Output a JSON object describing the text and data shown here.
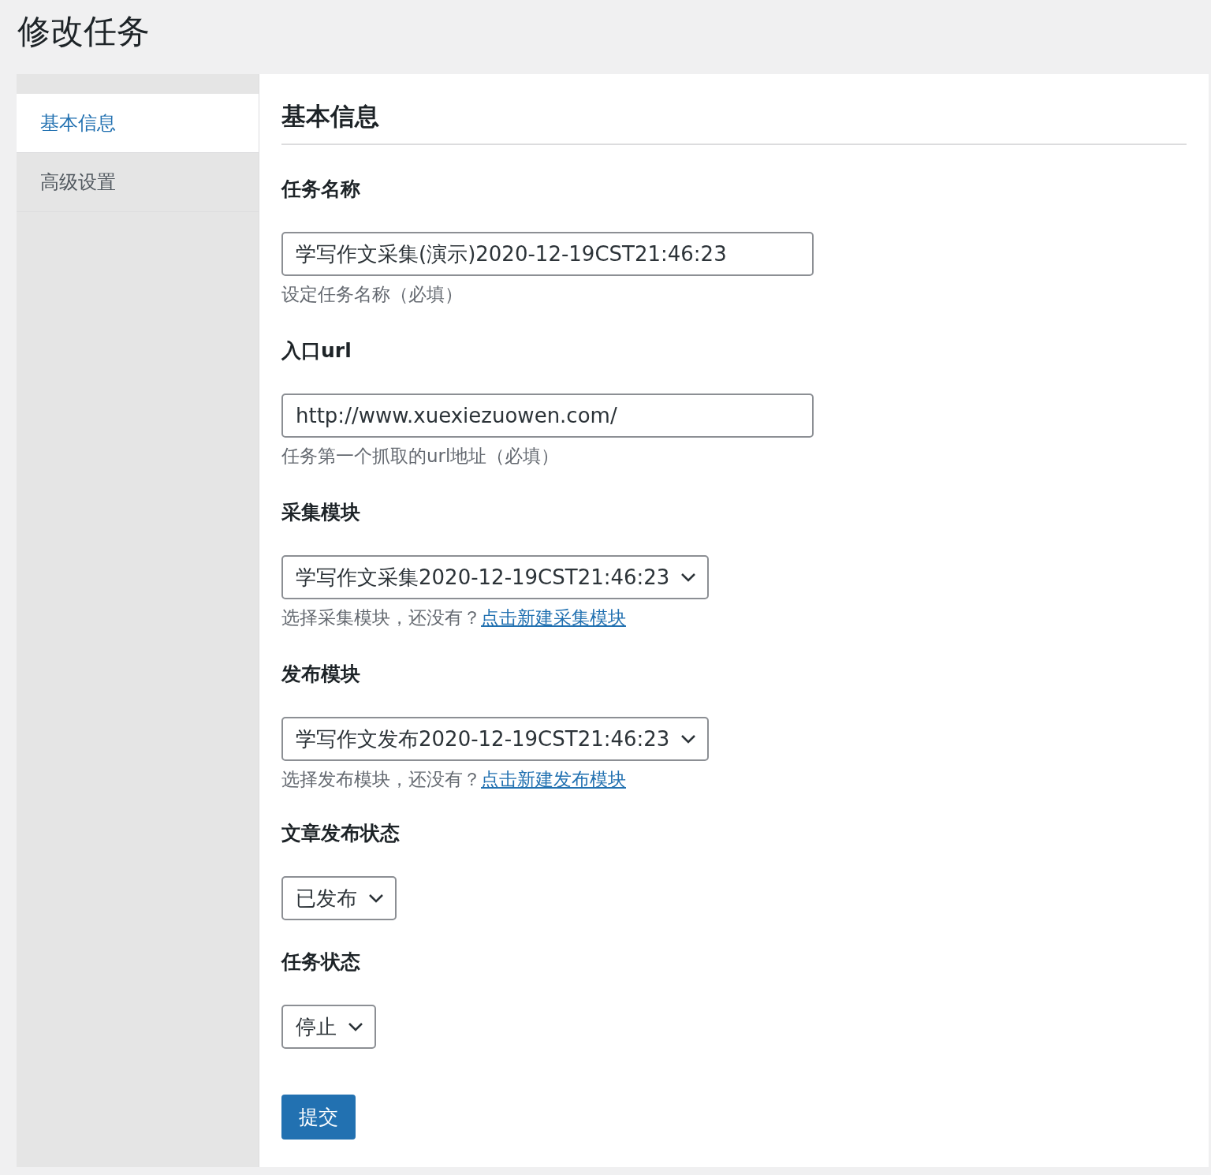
{
  "page_title": "修改任务",
  "sidebar": {
    "items": [
      {
        "label": "基本信息",
        "selected": true
      },
      {
        "label": "高级设置",
        "selected": false
      }
    ]
  },
  "section_title": "基本信息",
  "fields": [
    {
      "kind": "text",
      "label": "任务名称",
      "value": "学写作文采集(演示)2020-12-19CST21:46:23",
      "hint": "设定任务名称（必填）"
    },
    {
      "kind": "text",
      "label": "入口url",
      "value": "http://www.xuexiezuowen.com/",
      "hint": "任务第一个抓取的url地址（必填）"
    },
    {
      "kind": "select",
      "label": "采集模块",
      "value": "学写作文采集2020-12-19CST21:46:23",
      "hint": "选择采集模块，还没有？",
      "hint_link": "点击新建采集模块"
    },
    {
      "kind": "select",
      "label": "发布模块",
      "value": "学写作文发布2020-12-19CST21:46:23",
      "hint": "选择发布模块，还没有？",
      "hint_link": "点击新建发布模块"
    },
    {
      "kind": "select",
      "label": "文章发布状态",
      "value": "已发布"
    },
    {
      "kind": "select",
      "label": "任务状态",
      "value": "停止"
    }
  ],
  "submit": "提交"
}
